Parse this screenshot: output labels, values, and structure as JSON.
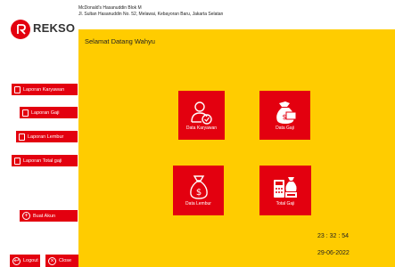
{
  "company": {
    "name": "REKSO",
    "address_line1": "McDonald's Hasanuddin Blok M",
    "address_line2": "Jl. Sultan Hasanuddin No. 52, Melawai, Kebayoran Baru, Jakarta Selatan"
  },
  "main": {
    "welcome": "Selamat Datang Wahyu"
  },
  "sidebar": {
    "items": [
      {
        "label": "Laporan Karyawan"
      },
      {
        "label": "Laporan Gaji"
      },
      {
        "label": "Laporan Lembur"
      },
      {
        "label": "Laporan Total gaji"
      }
    ],
    "create_account": "Buat Akun",
    "logout": "Logout",
    "close": "Close"
  },
  "tiles": [
    {
      "label": "Data Karyawan",
      "icon": "employee-icon"
    },
    {
      "label": "Data Gaji",
      "icon": "salary-bag-icon"
    },
    {
      "label": "Data Lembur",
      "icon": "money-bag-icon"
    },
    {
      "label": "Total Gaji",
      "icon": "calculator-money-icon"
    }
  ],
  "status": {
    "time": "23 : 32 : 54",
    "date": "29-06-2022"
  },
  "colors": {
    "brand_red": "#e3000f",
    "panel_yellow": "#ffcc00"
  }
}
